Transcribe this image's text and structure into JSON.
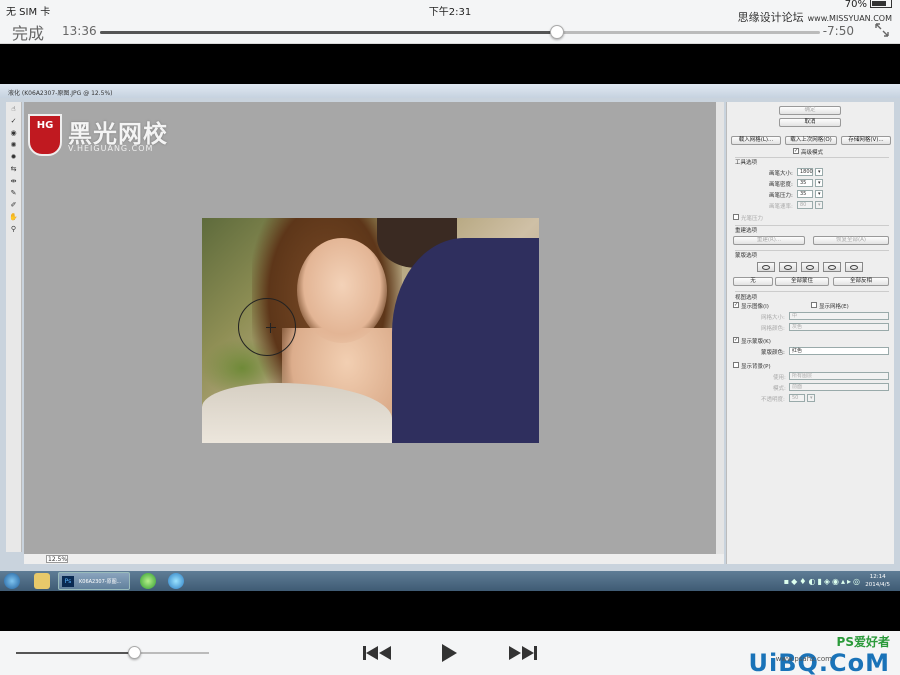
{
  "ios_status": {
    "carrier": "无 SIM 卡",
    "time": "下午2:31",
    "battery": "70%",
    "watermark_cn": "思缘设计论坛",
    "watermark_url": "www.MISSYUAN.COM"
  },
  "player": {
    "done_label": "完成",
    "elapsed": "13:36",
    "remaining": "-7:50",
    "progress_fraction": 0.635,
    "volume_fraction": 0.61
  },
  "dialog": {
    "title": "液化 (K06A2307-原图.JPG @ 12.5%)",
    "zoom": "12.5%"
  },
  "logo": {
    "badge": "HG",
    "name": "黑光网校",
    "url": "V.HEIGUANG.COM"
  },
  "panel": {
    "ok": "确定",
    "cancel": "取消",
    "load_mesh": "载入网格(L)...",
    "load_last_mesh": "载入上次网格(O)",
    "save_mesh": "存储网格(V)...",
    "advanced_mode": "高级模式",
    "tool_options": "工具选项",
    "brush_size_label": "画笔大小:",
    "brush_size": "1800",
    "brush_density_label": "画笔密度:",
    "brush_density": "35",
    "brush_pressure_label": "画笔压力:",
    "brush_pressure": "35",
    "brush_rate_label": "画笔速率:",
    "brush_rate": "80",
    "stylus_pressure": "光笔压力",
    "reconstruct_options": "重建选项",
    "reconstruct": "重建(R)...",
    "restore_all": "恢复全部(A)",
    "mask_options": "蒙版选项",
    "none": "无",
    "mask_all": "全部蒙住",
    "invert_all": "全部反相",
    "view_options": "视图选项",
    "show_image": "显示图像(I)",
    "show_mesh": "显示网格(E)",
    "mesh_size_label": "网格大小:",
    "mesh_size": "中",
    "mesh_color_label": "网格颜色:",
    "mesh_color": "灰色",
    "show_mask": "显示蒙版(K)",
    "mask_color_label": "蒙版颜色:",
    "mask_color": "红色",
    "show_backdrop": "显示背景(P)",
    "use_label": "使用:",
    "use_value": "所有图层",
    "mode_label": "模式:",
    "mode_value": "前面",
    "opacity_label": "不透明度:",
    "opacity_value": "50"
  },
  "taskbar": {
    "ps_label": "K06A2307-原图...",
    "ps_icon": "Ps",
    "clock_time": "12:14",
    "clock_date": "2014/4/5"
  },
  "site_watermark": {
    "ps": "PS爱好者",
    "uibq": "UiBQ.CoM",
    "sub": "www.psahz.com"
  },
  "colors": {
    "ios_bar": "#f4f5f6",
    "canvas": "#a7a7a7",
    "panel": "#eeeeee",
    "taskbar": "#4b6780"
  }
}
